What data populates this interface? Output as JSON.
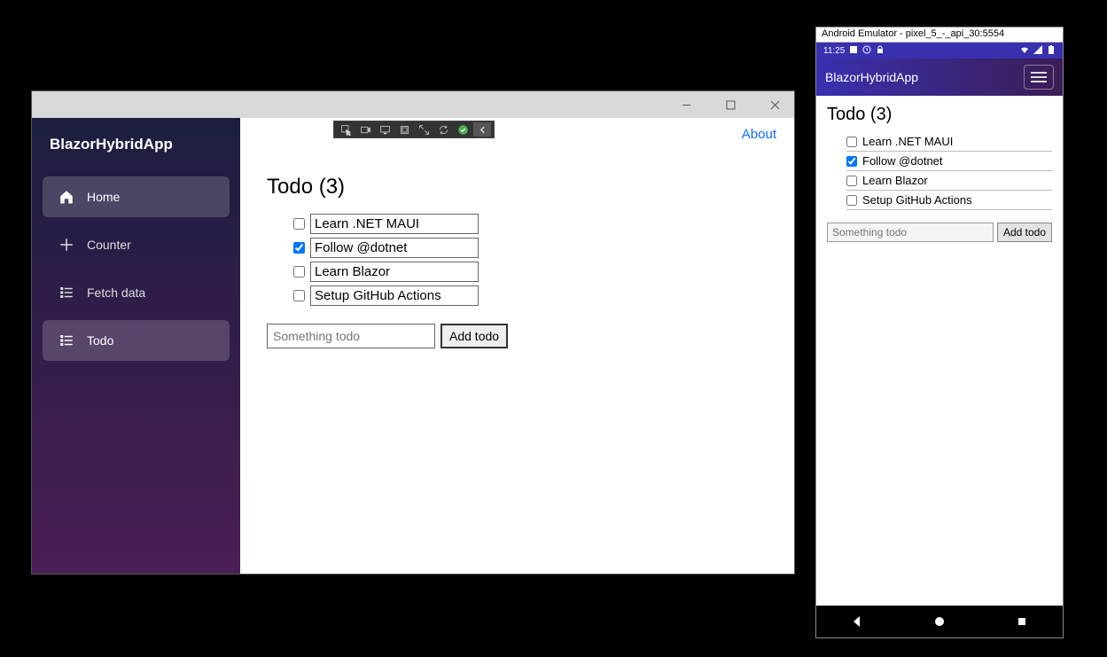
{
  "desktop": {
    "brand": "BlazorHybridApp",
    "nav": {
      "home": {
        "label": "Home"
      },
      "counter": {
        "label": "Counter"
      },
      "fetch": {
        "label": "Fetch data"
      },
      "todo": {
        "label": "Todo"
      }
    },
    "about": "About",
    "page_title": "Todo (3)",
    "todos": {
      "0": {
        "text": "Learn .NET MAUI",
        "done": false
      },
      "1": {
        "text": "Follow @dotnet",
        "done": true
      },
      "2": {
        "text": "Learn Blazor",
        "done": false
      },
      "3": {
        "text": "Setup GitHub Actions",
        "done": false
      }
    },
    "new_placeholder": "Something todo",
    "add_label": "Add todo"
  },
  "emulator": {
    "window_title": "Android Emulator - pixel_5_-_api_30:5554",
    "status_time": "11:25",
    "brand": "BlazorHybridApp",
    "page_title": "Todo (3)",
    "todos": {
      "0": {
        "text": "Learn .NET MAUI",
        "done": false
      },
      "1": {
        "text": "Follow @dotnet",
        "done": true
      },
      "2": {
        "text": "Learn Blazor",
        "done": false
      },
      "3": {
        "text": "Setup GitHub Actions",
        "done": false
      }
    },
    "new_placeholder": "Something todo",
    "add_label": "Add todo"
  }
}
